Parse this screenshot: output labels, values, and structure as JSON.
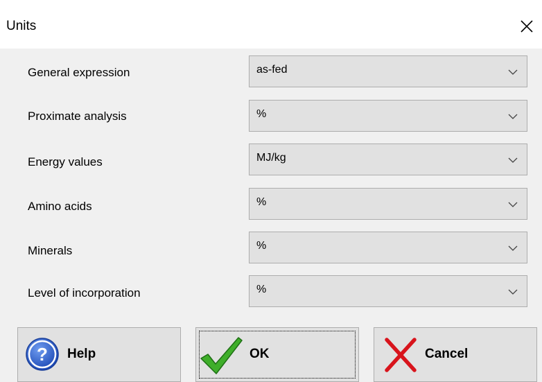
{
  "window": {
    "title": "Units",
    "close_icon": "close-icon"
  },
  "fields": [
    {
      "label": "General expression",
      "value": "as-fed"
    },
    {
      "label": "Proximate analysis",
      "value": "%"
    },
    {
      "label": "Energy values",
      "value": "MJ/kg"
    },
    {
      "label": "Amino acids",
      "value": "%"
    },
    {
      "label": "Minerals",
      "value": "%"
    },
    {
      "label": "Level of incorporation",
      "value": "%"
    }
  ],
  "buttons": {
    "help": {
      "label": "Help",
      "icon": "help-icon"
    },
    "ok": {
      "label": "OK",
      "icon": "checkmark-icon"
    },
    "cancel": {
      "label": "Cancel",
      "icon": "cross-icon"
    }
  },
  "colors": {
    "help_icon": "#2a62c9",
    "ok_icon": "#3fae2a",
    "cancel_icon": "#d8141c"
  }
}
